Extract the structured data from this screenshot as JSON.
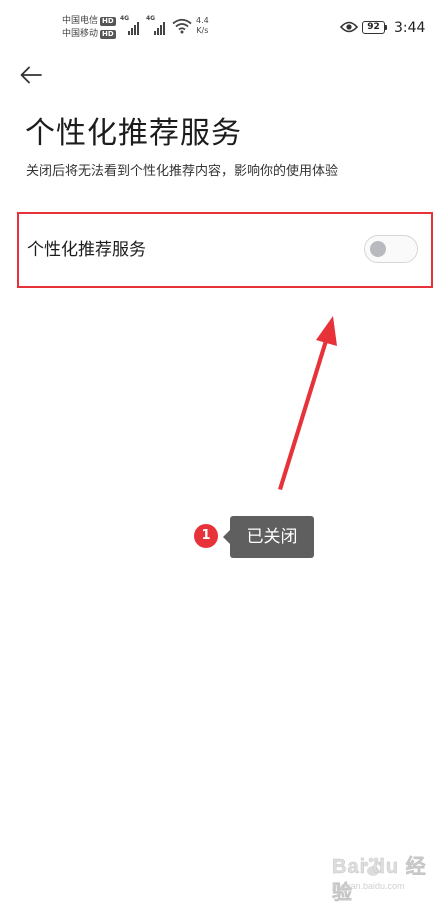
{
  "status_bar": {
    "carrier_1": "中国电信",
    "carrier_2": "中国移动",
    "hd_label": "HD",
    "network_tag": "4G",
    "net_speed_value": "4.4",
    "net_speed_unit": "K/s",
    "battery_level": "92",
    "time": "3:44",
    "icons": [
      "signal-icon",
      "wifi-icon",
      "eye-icon",
      "battery-icon"
    ]
  },
  "nav": {
    "back_icon": "arrow-left-icon"
  },
  "header": {
    "title": "个性化推荐服务",
    "subtitle": "关闭后将无法看到个性化推荐内容，影响你的使用体验"
  },
  "setting": {
    "label": "个性化推荐服务",
    "toggle_on": false
  },
  "annotation": {
    "step_number": "1",
    "callout_text": "已关闭",
    "accent_color": "#e8323a"
  },
  "watermark": {
    "text": "Bai du 经验",
    "sub": "jingyan.baidu.com"
  }
}
